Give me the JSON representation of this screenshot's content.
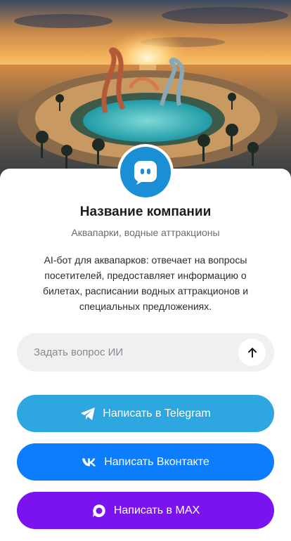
{
  "company": {
    "name": "Название компании",
    "category": "Аквапарки, водные аттракционы",
    "description": "AI-бот для аквапарков: отвечает на вопросы посетителей, предоставляет информацию о билетах, расписании водных аттракционов и специальных предложениях."
  },
  "ask": {
    "placeholder": "Задать вопрос ИИ",
    "send_icon": "arrow-up-icon"
  },
  "buttons": [
    {
      "label": "Написать в Telegram",
      "icon": "telegram-icon",
      "color": "#2ea6df"
    },
    {
      "label": "Написать Вконтакте",
      "icon": "vk-icon",
      "color": "#0b7dfd"
    },
    {
      "label": "Написать в MAX",
      "icon": "max-icon",
      "color": "#7b12f0"
    }
  ],
  "colors": {
    "avatar": "#1a8fd6",
    "ask_background": "#f0f0f2"
  }
}
